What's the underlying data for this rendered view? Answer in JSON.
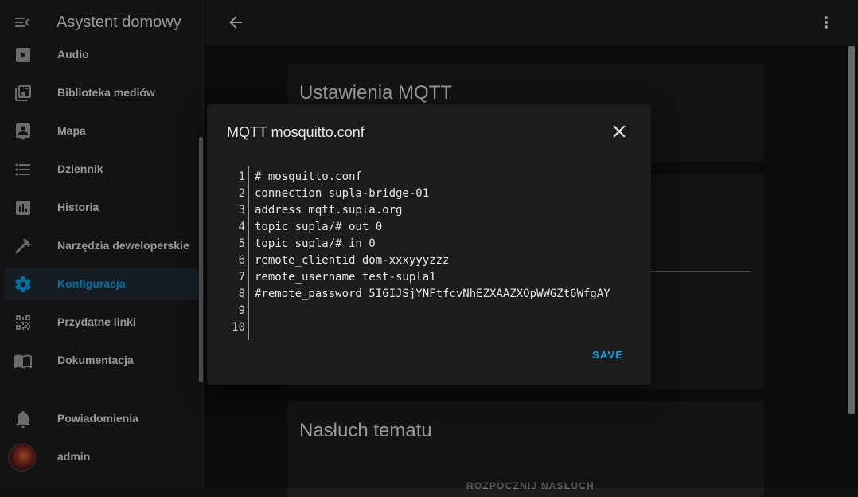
{
  "sidebar": {
    "title": "Asystent domowy",
    "items": [
      {
        "label": "Audio",
        "icon": "play-box-icon"
      },
      {
        "label": "Biblioteka mediów",
        "icon": "media-library-icon"
      },
      {
        "label": "Mapa",
        "icon": "map-account-icon"
      },
      {
        "label": "Dziennik",
        "icon": "list-icon"
      },
      {
        "label": "Historia",
        "icon": "chart-box-icon"
      },
      {
        "label": "Narzędzia deweloperskie",
        "icon": "hammer-icon"
      },
      {
        "label": "Konfiguracja",
        "icon": "cog-icon",
        "active": true
      },
      {
        "label": "Przydatne linki",
        "icon": "qrcode-icon"
      },
      {
        "label": "Dokumentacja",
        "icon": "book-icon"
      }
    ],
    "notifications_label": "Powiadomienia",
    "user_label": "admin"
  },
  "main": {
    "card1_title": "Ustawienia MQTT",
    "card3_title": "Nasłuch tematu",
    "listen_button": "ROZPOCZNIJ NASŁUCH"
  },
  "dialog": {
    "title": "MQTT mosquitto.conf",
    "save_label": "SAVE",
    "lines": [
      {
        "num": "1",
        "text": "# mosquitto.conf"
      },
      {
        "num": "2",
        "text": "connection supla-bridge-01"
      },
      {
        "num": "3",
        "text": "address mqtt.supla.org"
      },
      {
        "num": "4",
        "text": "topic supla/# out 0"
      },
      {
        "num": "5",
        "text": "topic supla/# in 0"
      },
      {
        "num": "6",
        "text": "remote_clientid dom-xxxyyyzzz"
      },
      {
        "num": "7",
        "text": "remote_username test-supla1"
      },
      {
        "num": "8",
        "text": "#remote_password 5I6IJSjYNFtfcvNhEZXAAZXOpWWGZt6WfgAY"
      },
      {
        "num": "9",
        "text": ""
      },
      {
        "num": "10",
        "text": ""
      }
    ]
  },
  "colors": {
    "accent": "#03a9f4",
    "background": "#111111",
    "card": "#1c1c1c"
  }
}
